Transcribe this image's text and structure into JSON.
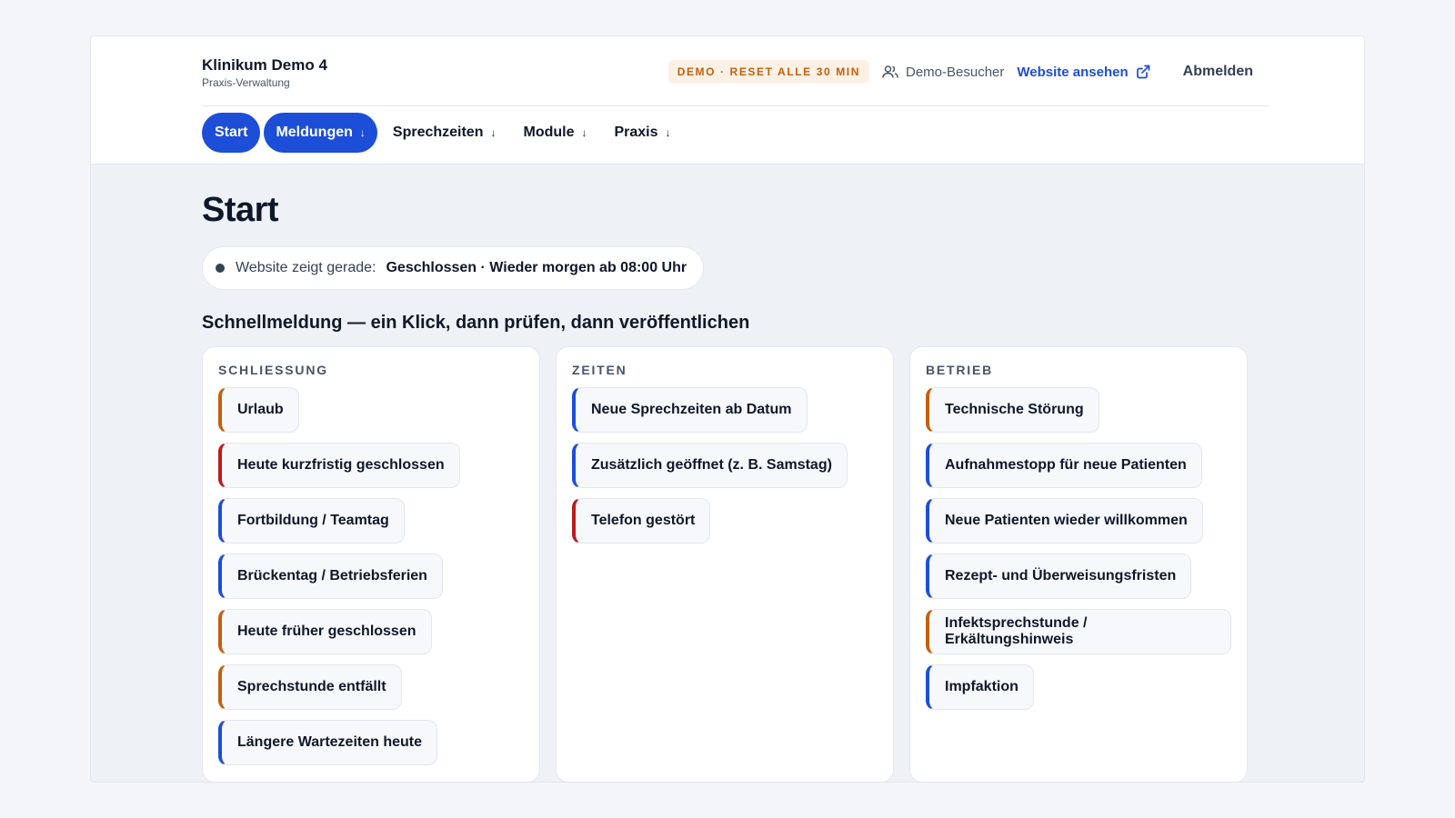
{
  "brand": {
    "title": "Klinikum Demo 4",
    "subtitle": "Praxis-Verwaltung"
  },
  "header": {
    "demo_badge": "DEMO · RESET ALLE 30 MIN",
    "visitor_label": "Demo-Besucher",
    "visitor_icon": "users-icon",
    "site_link": "Website ansehen",
    "site_link_icon": "external-link-icon",
    "logout": "Abmelden"
  },
  "nav": [
    {
      "label": "Start",
      "active": true,
      "dropdown": false
    },
    {
      "label": "Meldungen",
      "active": true,
      "dropdown": true
    },
    {
      "label": "Sprechzeiten",
      "active": false,
      "dropdown": true
    },
    {
      "label": "Module",
      "active": false,
      "dropdown": true
    },
    {
      "label": "Praxis",
      "active": false,
      "dropdown": true
    }
  ],
  "page": {
    "title": "Start",
    "status_label": "Website zeigt gerade:",
    "status_value": "Geschlossen · Wieder morgen ab 08:00 Uhr",
    "section_title": "Schnellmeldung — ein Klick, dann prüfen, dann veröffentlichen"
  },
  "colors": {
    "primary": "#1d4ed8",
    "orange": "#c2600e",
    "red": "#b91c1c"
  },
  "columns": [
    {
      "heading": "SCHLIESSUNG",
      "items": [
        {
          "label": "Urlaub",
          "color": "orange"
        },
        {
          "label": "Heute kurzfristig geschlossen",
          "color": "red"
        },
        {
          "label": "Fortbildung / Teamtag",
          "color": "blue"
        },
        {
          "label": "Brückentag / Betriebsferien",
          "color": "blue"
        },
        {
          "label": "Heute früher geschlossen",
          "color": "orange"
        },
        {
          "label": "Sprechstunde entfällt",
          "color": "orange"
        },
        {
          "label": "Längere Wartezeiten heute",
          "color": "blue"
        }
      ]
    },
    {
      "heading": "ZEITEN",
      "items": [
        {
          "label": "Neue Sprechzeiten ab Datum",
          "color": "blue"
        },
        {
          "label": "Zusätzlich geöffnet (z. B. Samstag)",
          "color": "blue"
        },
        {
          "label": "Telefon gestört",
          "color": "red"
        }
      ]
    },
    {
      "heading": "BETRIEB",
      "items": [
        {
          "label": "Technische Störung",
          "color": "orange"
        },
        {
          "label": "Aufnahmestopp für neue Patienten",
          "color": "blue"
        },
        {
          "label": "Neue Patienten wieder willkommen",
          "color": "blue"
        },
        {
          "label": "Rezept- und Überweisungsfristen",
          "color": "blue"
        },
        {
          "label": "Infektsprechstunde / Erkältungshinweis",
          "color": "orange"
        },
        {
          "label": "Impfaktion",
          "color": "blue"
        }
      ]
    }
  ]
}
